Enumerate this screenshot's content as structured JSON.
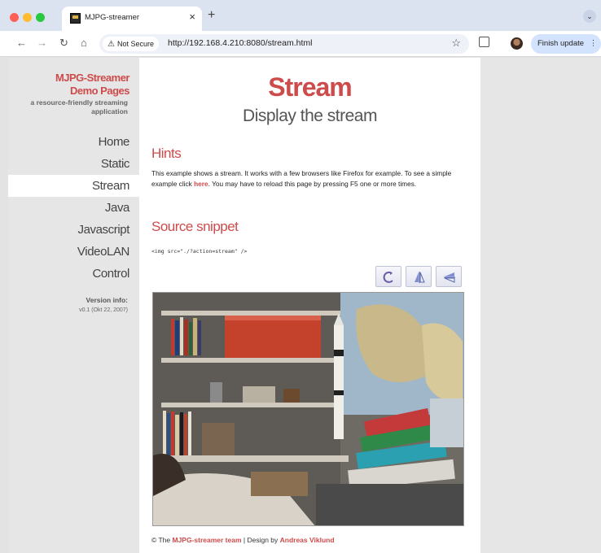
{
  "browser": {
    "tab_title": "MJPG-streamer",
    "tab_close": "×",
    "new_tab": "+",
    "security_label": "Not Secure",
    "url": "http://192.168.4.210:8080/stream.html",
    "update_button": "Finish update",
    "more": "⋮",
    "tab_search": "⌄"
  },
  "sidebar": {
    "brand_line1": "MJPG-Streamer",
    "brand_line2": "Demo Pages",
    "brand_subtitle": "a resource-friendly streaming application",
    "menu": [
      {
        "label": "Home",
        "active": false
      },
      {
        "label": "Static",
        "active": false
      },
      {
        "label": "Stream",
        "active": true
      },
      {
        "label": "Java",
        "active": false
      },
      {
        "label": "Javascript",
        "active": false
      },
      {
        "label": "VideoLAN",
        "active": false
      },
      {
        "label": "Control",
        "active": false
      }
    ],
    "version_label": "Version info:",
    "version_value": "v0.1 (Okt 22, 2007)"
  },
  "main": {
    "title": "Stream",
    "subtitle": "Display the stream",
    "hints_heading": "Hints",
    "hints_before": "This example shows a stream. It works with a few browsers like Firefox for example. To see a simple example click ",
    "hints_link": "here",
    "hints_after": ". You may have to reload this page by pressing F5 one or more times.",
    "snippet_heading": "Source snippet",
    "snippet_code": "<img src=\"./?action=stream\" />",
    "buttons": [
      {
        "icon": "rotate-icon"
      },
      {
        "icon": "flip-icon"
      },
      {
        "icon": "mirror-icon"
      }
    ],
    "footer_prefix": "© The ",
    "footer_team": "MJPG-streamer team",
    "footer_mid": " | Design by ",
    "footer_designer": "Andreas Viklund"
  },
  "colors": {
    "accent": "#cd4b4b",
    "sidebar_bg": "#e6e6e6",
    "update_button_bg": "#d3e2fd"
  }
}
